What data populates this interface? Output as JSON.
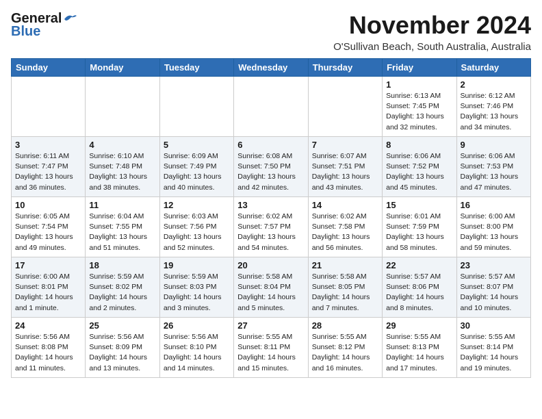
{
  "logo": {
    "line1": "General",
    "line2": "Blue"
  },
  "title": "November 2024",
  "location": "O'Sullivan Beach, South Australia, Australia",
  "weekdays": [
    "Sunday",
    "Monday",
    "Tuesday",
    "Wednesday",
    "Thursday",
    "Friday",
    "Saturday"
  ],
  "weeks": [
    [
      {
        "day": "",
        "info": ""
      },
      {
        "day": "",
        "info": ""
      },
      {
        "day": "",
        "info": ""
      },
      {
        "day": "",
        "info": ""
      },
      {
        "day": "",
        "info": ""
      },
      {
        "day": "1",
        "info": "Sunrise: 6:13 AM\nSunset: 7:45 PM\nDaylight: 13 hours\nand 32 minutes."
      },
      {
        "day": "2",
        "info": "Sunrise: 6:12 AM\nSunset: 7:46 PM\nDaylight: 13 hours\nand 34 minutes."
      }
    ],
    [
      {
        "day": "3",
        "info": "Sunrise: 6:11 AM\nSunset: 7:47 PM\nDaylight: 13 hours\nand 36 minutes."
      },
      {
        "day": "4",
        "info": "Sunrise: 6:10 AM\nSunset: 7:48 PM\nDaylight: 13 hours\nand 38 minutes."
      },
      {
        "day": "5",
        "info": "Sunrise: 6:09 AM\nSunset: 7:49 PM\nDaylight: 13 hours\nand 40 minutes."
      },
      {
        "day": "6",
        "info": "Sunrise: 6:08 AM\nSunset: 7:50 PM\nDaylight: 13 hours\nand 42 minutes."
      },
      {
        "day": "7",
        "info": "Sunrise: 6:07 AM\nSunset: 7:51 PM\nDaylight: 13 hours\nand 43 minutes."
      },
      {
        "day": "8",
        "info": "Sunrise: 6:06 AM\nSunset: 7:52 PM\nDaylight: 13 hours\nand 45 minutes."
      },
      {
        "day": "9",
        "info": "Sunrise: 6:06 AM\nSunset: 7:53 PM\nDaylight: 13 hours\nand 47 minutes."
      }
    ],
    [
      {
        "day": "10",
        "info": "Sunrise: 6:05 AM\nSunset: 7:54 PM\nDaylight: 13 hours\nand 49 minutes."
      },
      {
        "day": "11",
        "info": "Sunrise: 6:04 AM\nSunset: 7:55 PM\nDaylight: 13 hours\nand 51 minutes."
      },
      {
        "day": "12",
        "info": "Sunrise: 6:03 AM\nSunset: 7:56 PM\nDaylight: 13 hours\nand 52 minutes."
      },
      {
        "day": "13",
        "info": "Sunrise: 6:02 AM\nSunset: 7:57 PM\nDaylight: 13 hours\nand 54 minutes."
      },
      {
        "day": "14",
        "info": "Sunrise: 6:02 AM\nSunset: 7:58 PM\nDaylight: 13 hours\nand 56 minutes."
      },
      {
        "day": "15",
        "info": "Sunrise: 6:01 AM\nSunset: 7:59 PM\nDaylight: 13 hours\nand 58 minutes."
      },
      {
        "day": "16",
        "info": "Sunrise: 6:00 AM\nSunset: 8:00 PM\nDaylight: 13 hours\nand 59 minutes."
      }
    ],
    [
      {
        "day": "17",
        "info": "Sunrise: 6:00 AM\nSunset: 8:01 PM\nDaylight: 14 hours\nand 1 minute."
      },
      {
        "day": "18",
        "info": "Sunrise: 5:59 AM\nSunset: 8:02 PM\nDaylight: 14 hours\nand 2 minutes."
      },
      {
        "day": "19",
        "info": "Sunrise: 5:59 AM\nSunset: 8:03 PM\nDaylight: 14 hours\nand 3 minutes."
      },
      {
        "day": "20",
        "info": "Sunrise: 5:58 AM\nSunset: 8:04 PM\nDaylight: 14 hours\nand 5 minutes."
      },
      {
        "day": "21",
        "info": "Sunrise: 5:58 AM\nSunset: 8:05 PM\nDaylight: 14 hours\nand 7 minutes."
      },
      {
        "day": "22",
        "info": "Sunrise: 5:57 AM\nSunset: 8:06 PM\nDaylight: 14 hours\nand 8 minutes."
      },
      {
        "day": "23",
        "info": "Sunrise: 5:57 AM\nSunset: 8:07 PM\nDaylight: 14 hours\nand 10 minutes."
      }
    ],
    [
      {
        "day": "24",
        "info": "Sunrise: 5:56 AM\nSunset: 8:08 PM\nDaylight: 14 hours\nand 11 minutes."
      },
      {
        "day": "25",
        "info": "Sunrise: 5:56 AM\nSunset: 8:09 PM\nDaylight: 14 hours\nand 13 minutes."
      },
      {
        "day": "26",
        "info": "Sunrise: 5:56 AM\nSunset: 8:10 PM\nDaylight: 14 hours\nand 14 minutes."
      },
      {
        "day": "27",
        "info": "Sunrise: 5:55 AM\nSunset: 8:11 PM\nDaylight: 14 hours\nand 15 minutes."
      },
      {
        "day": "28",
        "info": "Sunrise: 5:55 AM\nSunset: 8:12 PM\nDaylight: 14 hours\nand 16 minutes."
      },
      {
        "day": "29",
        "info": "Sunrise: 5:55 AM\nSunset: 8:13 PM\nDaylight: 14 hours\nand 17 minutes."
      },
      {
        "day": "30",
        "info": "Sunrise: 5:55 AM\nSunset: 8:14 PM\nDaylight: 14 hours\nand 19 minutes."
      }
    ]
  ]
}
